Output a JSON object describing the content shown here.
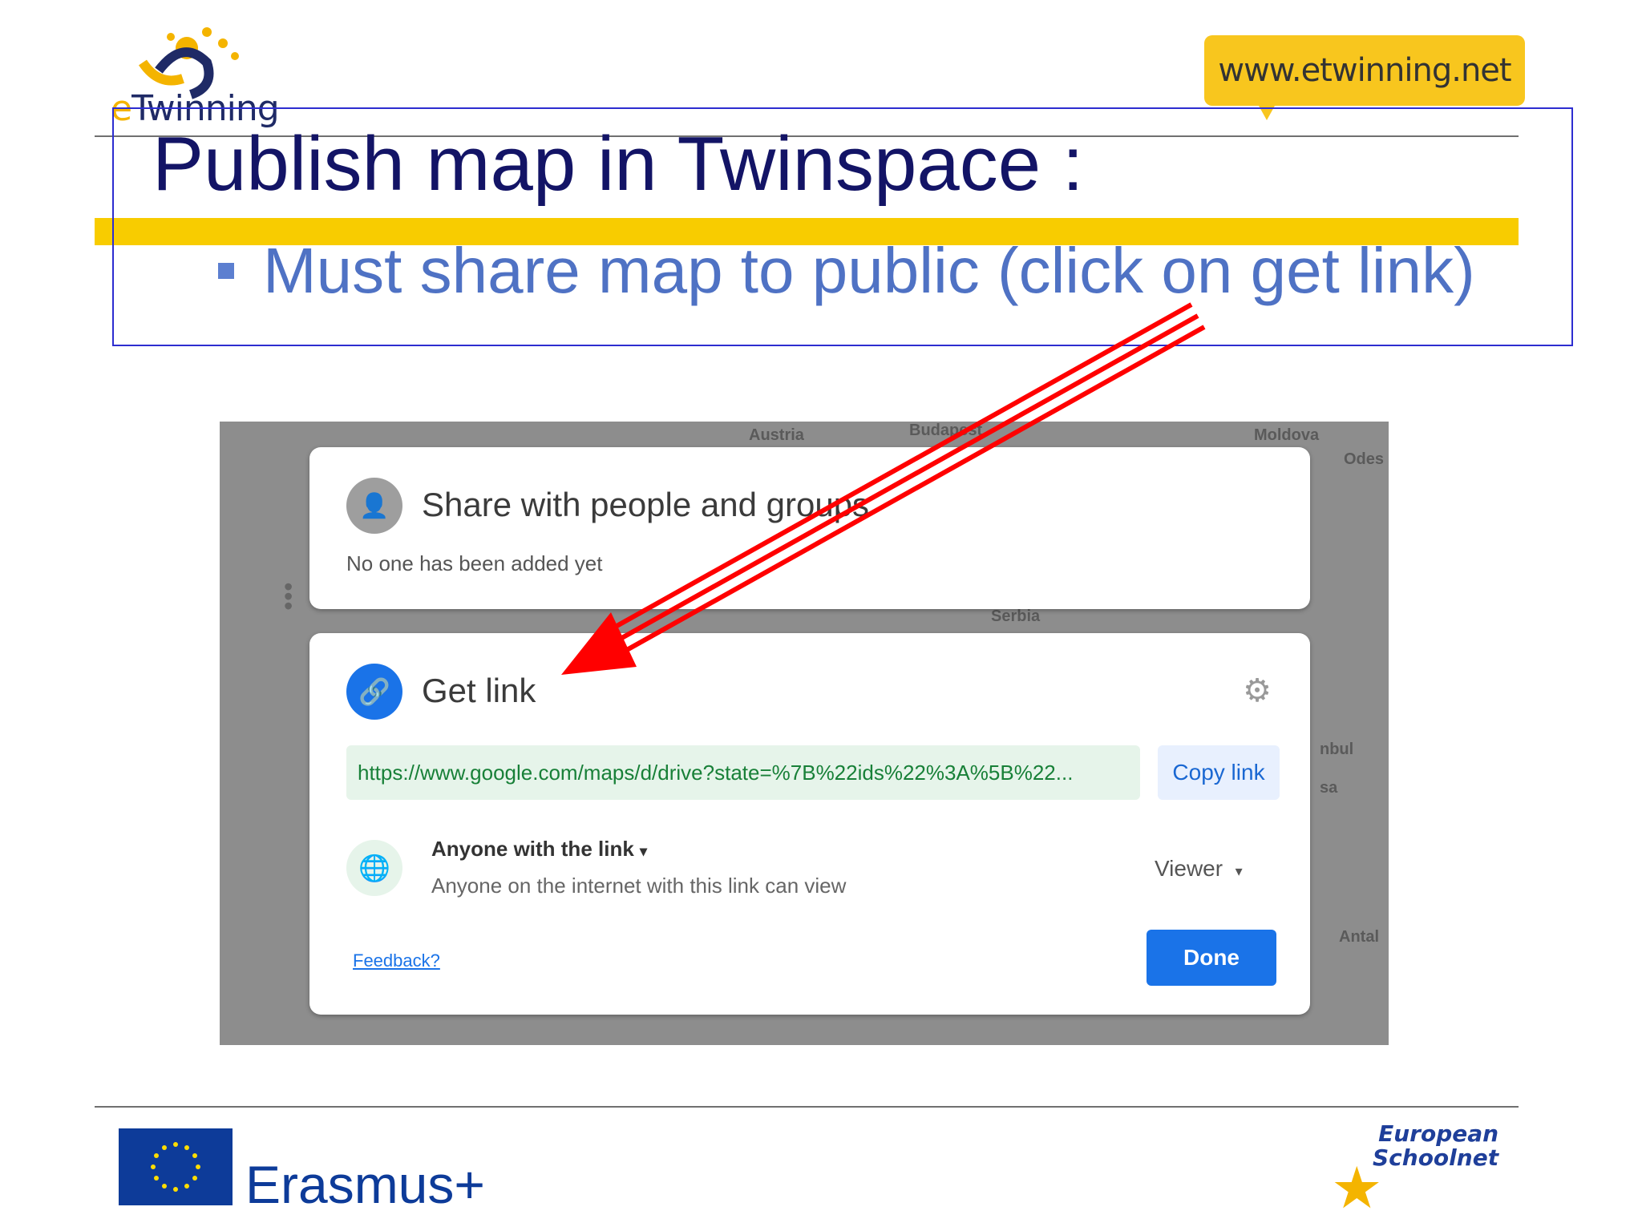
{
  "header": {
    "logo_text_e": "e",
    "logo_text": "Twinning",
    "url_badge": "www.etwinning.net"
  },
  "slide": {
    "title": "Publish map in Twinspace :",
    "bullet": "Must share map to public (click on get link)"
  },
  "screenshot": {
    "map_labels": [
      "Austria",
      "Budapest",
      "Moldova",
      "Odes",
      "Serbia",
      "nbul",
      "sa",
      "Antal"
    ],
    "share_card": {
      "title": "Share with people and groups",
      "subtitle": "No one has been added yet",
      "icon": "person-add-icon"
    },
    "link_card": {
      "title": "Get link",
      "icon": "link-icon",
      "settings_icon": "gear-icon",
      "link_value": "https://www.google.com/maps/d/drive?state=%7B%22ids%22%3A%5B%22...",
      "copy_label": "Copy link",
      "access_label": "Anyone with the link",
      "access_sub": "Anyone on the internet with this link can view",
      "role_label": "Viewer",
      "feedback_label": "Feedback?",
      "done_label": "Done"
    }
  },
  "footer": {
    "erasmus_label": "Erasmus+",
    "esn_line1": "European",
    "esn_line2": "Schoolnet"
  },
  "colors": {
    "title": "#131466",
    "bullet": "#4f72c4",
    "accent_yellow": "#f8cc00",
    "arrow": "#ff0000",
    "google_blue": "#1a73e8"
  }
}
